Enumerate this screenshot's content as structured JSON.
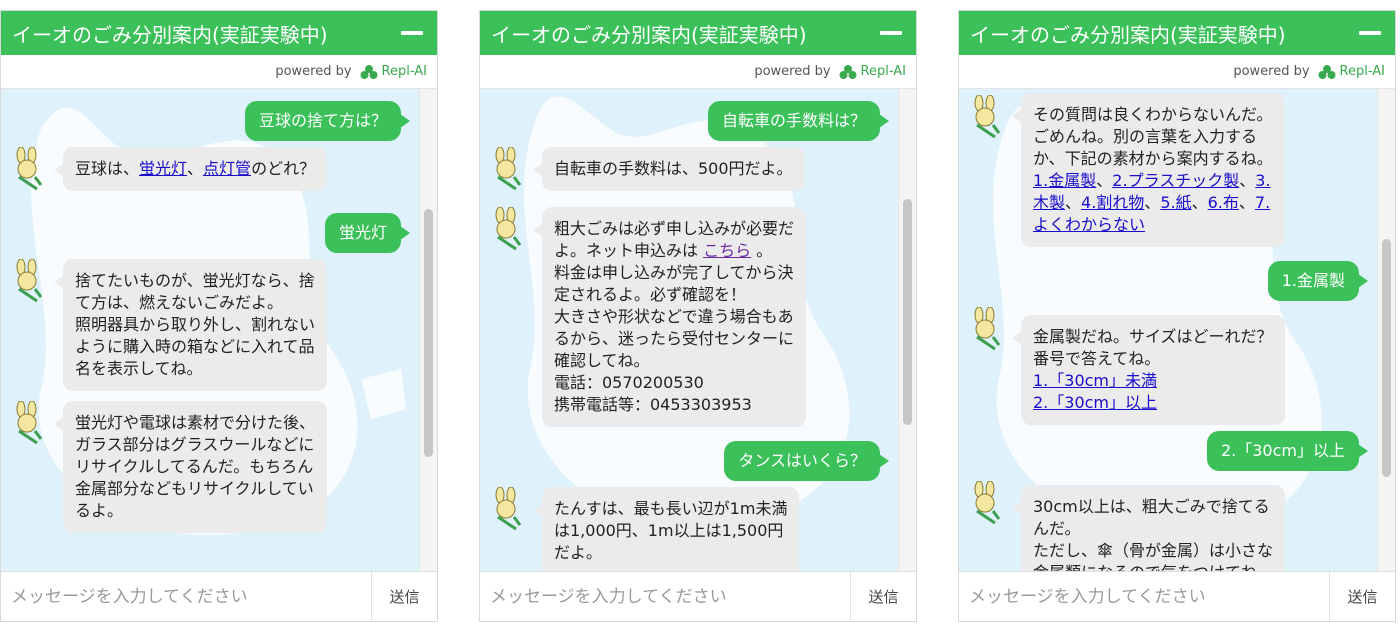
{
  "widget": {
    "title": "イーオのごみ分別案内(実証実験中)",
    "powered_by": "powered by",
    "brand": "Repl-AI",
    "input_placeholder": "メッセージを入力してください",
    "send_label": "送信"
  },
  "colors": {
    "accent": "#3cc05a",
    "chat_bg": "#dff1fb",
    "bot_bubble": "#ebebeb",
    "link": "#1a0dcc"
  },
  "panel1": {
    "u1": "豆球の捨て方は？",
    "b1_a": "豆球は、",
    "b1_link1": "蛍光灯",
    "b1_sep": "、",
    "b1_link2": "点灯管",
    "b1_b": "のどれ？",
    "u2": "蛍光灯",
    "b2": [
      "捨てたいものが、蛍光灯なら、捨",
      "て方は、燃えないごみだよ。",
      "照明器具から取り外し、割れない",
      "ように購入時の箱などに入れて品",
      "名を表示してね。"
    ],
    "b3": [
      "蛍光灯や電球は素材で分けた後、",
      "ガラス部分はグラスウールなどに",
      "リサイクルしてるんだ。もちろん",
      "金属部分などもリサイクルしてい",
      "るよ。"
    ]
  },
  "panel2": {
    "u1": "自転車の手数料は？",
    "b1": "自転車の手数料は、500円だよ。",
    "b2_l1": "粗大ごみは必ず申し込みが必要だ",
    "b2_l2a": "よ。ネット申込みは ",
    "b2_link": "こちら",
    "b2_l2b": " 。",
    "b2_rest": [
      "料金は申し込みが完了してから決",
      "定されるよ。必ず確認を！",
      "大きさや形状などで違う場合もあ",
      "るから、迷ったら受付センターに",
      "確認してね。",
      "電話：0570200530",
      "携帯電話等：0453303953"
    ],
    "u2": "タンスはいくら？",
    "b3": [
      "たんすは、最も長い辺が1m未満",
      "は1,000円、1m以上は1,500円",
      "だよ。"
    ]
  },
  "panel3": {
    "b1_lines": [
      "その質問は良くわからないんだ。",
      "ごめんね。別の言葉を入力する",
      "か、下記の素材から案内するね。"
    ],
    "b1_links": {
      "l1": "1.金属製",
      "s1": "、",
      "l2": "2.プラスチック製",
      "s2": "、",
      "l3a": "3.",
      "l3b": "木製",
      "s3": "、",
      "l4": "4.割れ物",
      "s4": "、",
      "l5": "5.紙",
      "s5": "、",
      "l6": "6.布",
      "s6": "、",
      "l7a": "7.",
      "l7b": "よくわからない"
    },
    "u1": "1.金属製",
    "b2_lines": [
      "金属製だね。サイズはどーれだ？",
      "番号で答えてね。"
    ],
    "b2_opt1": "1.「30cm」未満",
    "b2_opt2": "2.「30cm」以上",
    "u2": "2.「30cm」以上",
    "b3": [
      "30cm以上は、粗大ごみで捨てる",
      "んだ。",
      "ただし、傘（骨が金属）は小さな",
      "金属類になるので気をつけてね。"
    ]
  }
}
